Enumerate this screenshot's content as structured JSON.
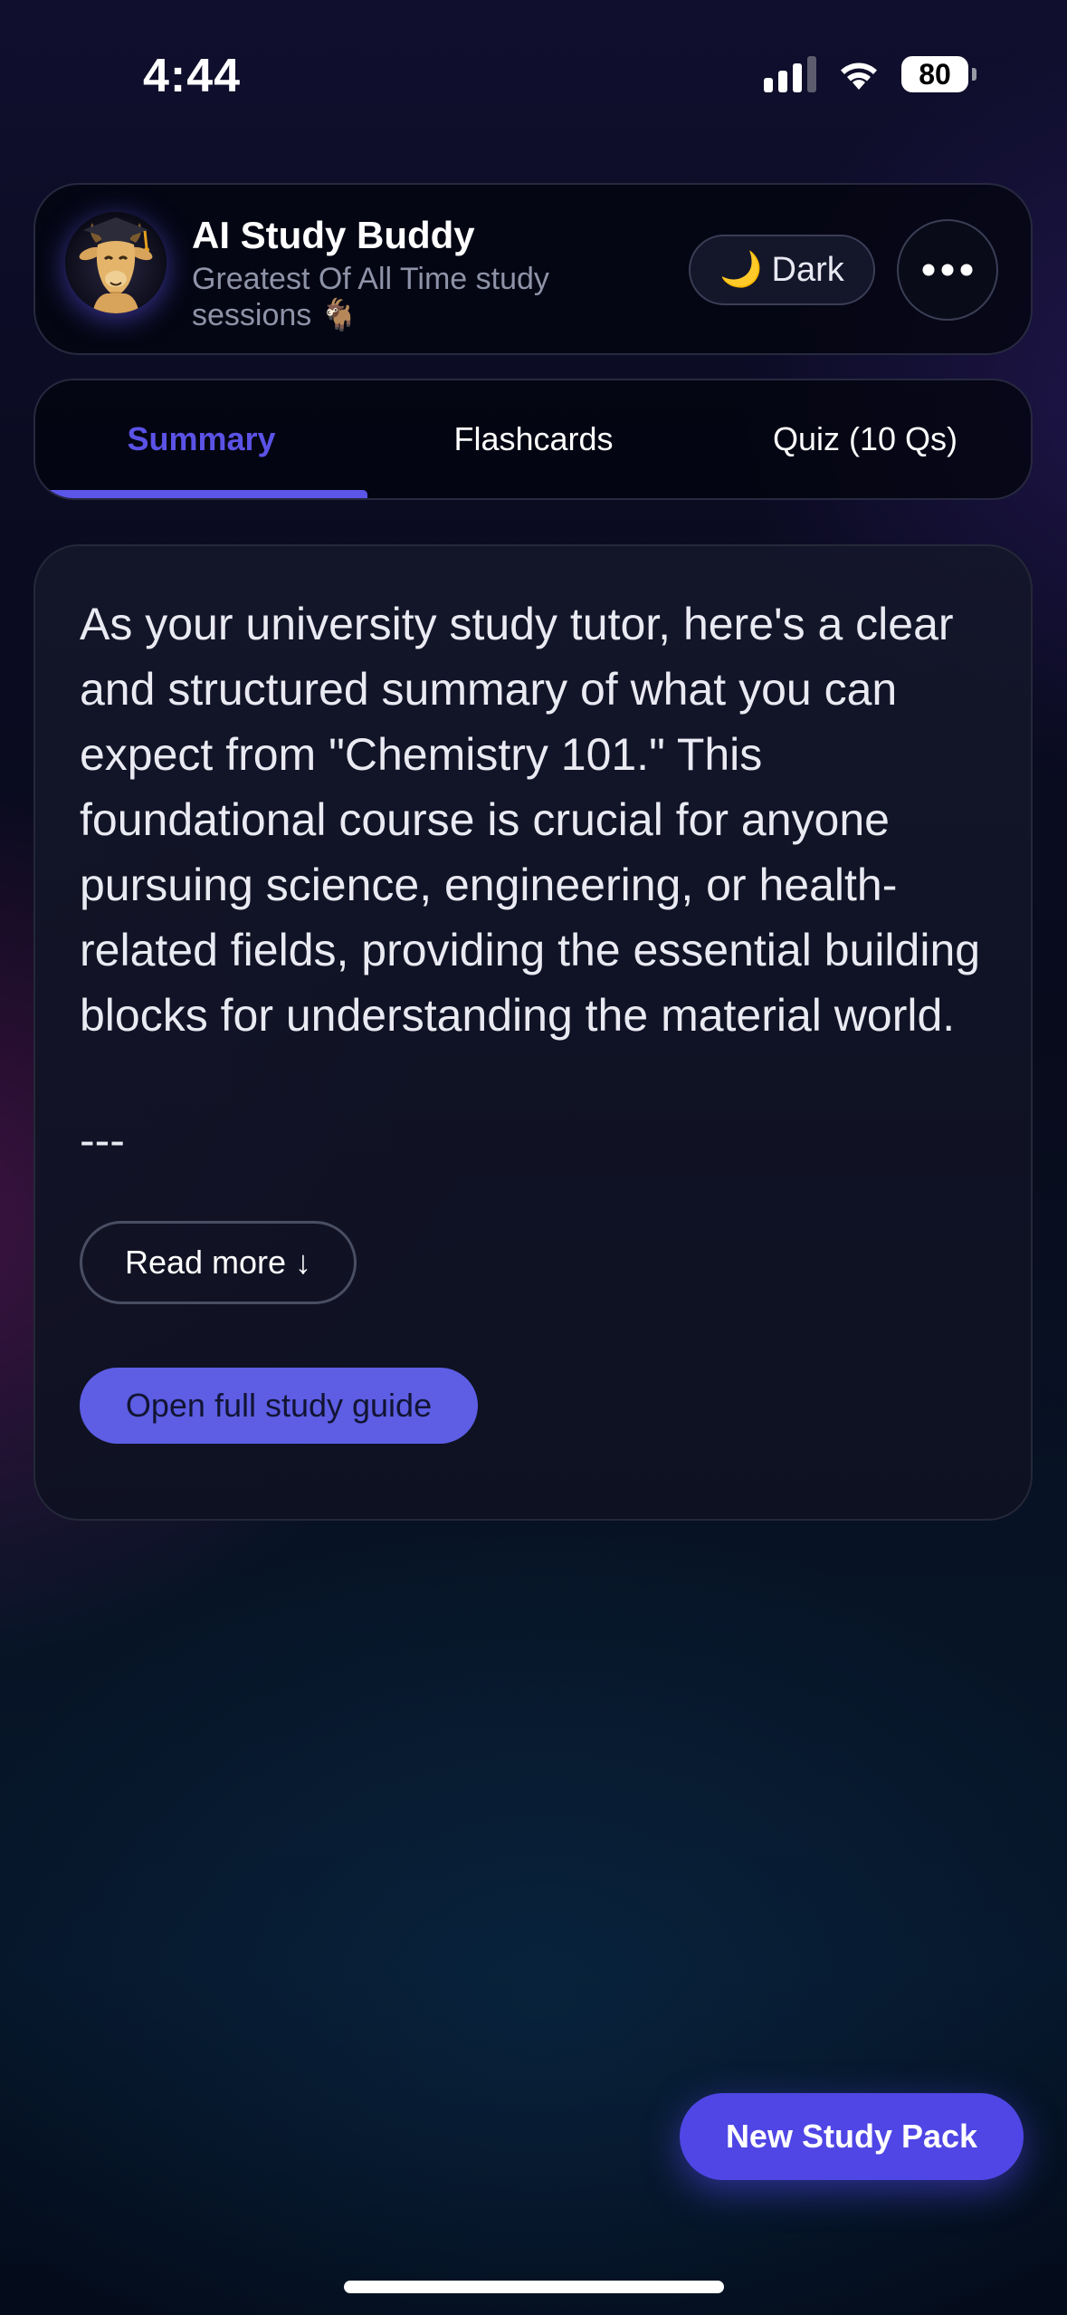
{
  "status_bar": {
    "time": "4:44",
    "battery": "80",
    "icons": [
      "cellular-signal-icon",
      "wifi-icon",
      "battery-icon"
    ]
  },
  "header": {
    "title": "AI Study Buddy",
    "subtitle": "Greatest Of All Time study sessions 🐐",
    "avatar_icon": "goat-graduate-avatar",
    "theme_toggle": {
      "icon": "moon-icon",
      "glyph": "🌙",
      "label": "Dark"
    },
    "more_icon": "more-icon"
  },
  "tabs": [
    {
      "label": "Summary",
      "active": true
    },
    {
      "label": "Flashcards",
      "active": false
    },
    {
      "label": "Quiz (10 Qs)",
      "active": false
    }
  ],
  "summary": {
    "text": "As your university study tutor, here's a clear and structured summary of what you can expect from \"Chemistry 101.\" This foundational course is crucial for anyone pursuing science, engineering, or health-related fields, providing the essential building blocks for understanding the material world.",
    "divider": "---",
    "read_more_label": "Read more",
    "read_more_icon": "arrow-down-icon",
    "read_more_glyph": "↓",
    "open_guide_label": "Open full study guide"
  },
  "fab": {
    "new_pack_label": "New Study Pack"
  },
  "colors": {
    "accent": "#4f46e5",
    "active_tab": "#5b52e6",
    "open_guide_bg": "#5d5ee4",
    "subtitle": "#8f93a8"
  }
}
